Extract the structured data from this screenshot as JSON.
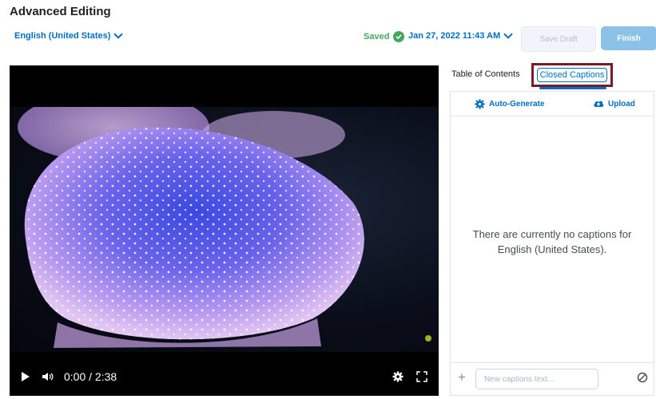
{
  "header": {
    "title": "Advanced Editing",
    "language": "English (United States)",
    "status": "Saved",
    "date": "Jan 27, 2022 11:43 AM",
    "save_draft_label": "Save Draft",
    "finish_label": "Finish"
  },
  "video": {
    "time": "0:00 / 2:38",
    "icons": [
      "play-icon",
      "volume-icon",
      "settings-icon",
      "fullscreen-icon"
    ]
  },
  "panel": {
    "tabs": [
      "Table of Contents",
      "Closed Captions"
    ],
    "active_tab": "Closed Captions",
    "auto_generate_label": "Auto-Generate",
    "upload_label": "Upload",
    "empty_message": "There are currently no captions for English (United States).",
    "caption_input_placeholder": "New captions text..."
  },
  "colors": {
    "accent": "#006fbf",
    "saved_green": "#46a661",
    "highlight_box": "#7a1a28"
  }
}
